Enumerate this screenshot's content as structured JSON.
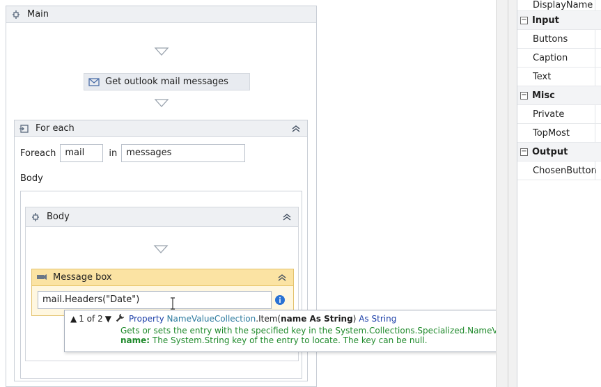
{
  "designer": {
    "main": {
      "title": "Main"
    },
    "get_mail": {
      "label": "Get outlook mail messages"
    },
    "foreach": {
      "title": "For each",
      "foreach_label": "Foreach",
      "item_value": "mail",
      "in_label": "in",
      "collection_value": "messages",
      "body_label": "Body"
    },
    "body_sequence": {
      "title": "Body"
    },
    "message_box": {
      "title": "Message box",
      "expression": "mail.Headers(\"Date\")"
    },
    "tooltip": {
      "overload": "1 of 2",
      "keyword": "Property",
      "type_name": "NameValueCollection",
      "member": ".Item(",
      "param_sig": "name As String",
      "close": ")",
      "as_kw": "As",
      "return_type": "String",
      "description": "Gets or sets the entry with the specified key in the System.Collections.Specialized.NameValueCollection.",
      "param_name": "name:",
      "param_desc": "The System.String key of the entry to locate. The key can be null."
    }
  },
  "properties": {
    "rows": [
      {
        "kind": "item",
        "label": "DisplayName"
      },
      {
        "kind": "cat",
        "label": "Input"
      },
      {
        "kind": "item",
        "label": "Buttons"
      },
      {
        "kind": "item",
        "label": "Caption"
      },
      {
        "kind": "item",
        "label": "Text"
      },
      {
        "kind": "cat",
        "label": "Misc"
      },
      {
        "kind": "item",
        "label": "Private"
      },
      {
        "kind": "item",
        "label": "TopMost"
      },
      {
        "kind": "cat",
        "label": "Output"
      },
      {
        "kind": "item",
        "label": "ChosenButton"
      }
    ]
  },
  "colors": {
    "message_box_header": "#fbe3a3",
    "tooltip_keyword": "#1c3fa8",
    "tooltip_description": "#1f8a2b"
  }
}
